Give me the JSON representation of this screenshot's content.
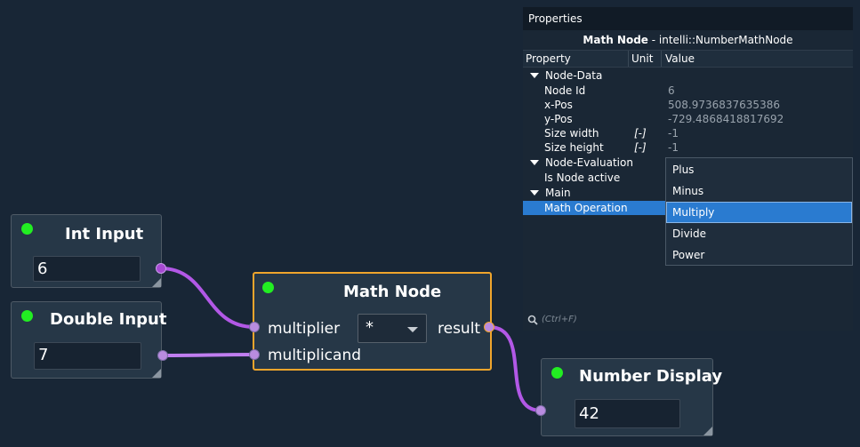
{
  "nodes": {
    "int_input": {
      "title": "Int Input",
      "value": "6"
    },
    "double_input": {
      "title": "Double Input",
      "value": "7"
    },
    "math_node": {
      "title": "Math Node",
      "in_ports": [
        "multiplier",
        "multiplicand"
      ],
      "out_port": "result",
      "operation": "*"
    },
    "number_display": {
      "title": "Number Display",
      "value": "42"
    }
  },
  "properties": {
    "panel_title": "Properties",
    "node_name": "Math Node",
    "node_class": " - intelli::NumberMathNode",
    "columns": {
      "property": "Property",
      "unit": "Unit",
      "value": "Value"
    },
    "groups": {
      "node_data": "Node-Data",
      "node_evaluation": "Node-Evaluation",
      "main": "Main"
    },
    "rows": {
      "node_id": {
        "label": "Node Id",
        "value": "6"
      },
      "x_pos": {
        "label": "x-Pos",
        "value": "508.9736837635386"
      },
      "y_pos": {
        "label": "y-Pos",
        "value": "-729.4868418817692"
      },
      "size_width": {
        "label": "Size width",
        "unit": "[-]",
        "value": "-1"
      },
      "size_height": {
        "label": "Size height",
        "unit": "[-]",
        "value": "-1"
      },
      "is_node_active": {
        "label": "Is Node active"
      },
      "math_operation": {
        "label": "Math Operation"
      }
    },
    "search_hint": "(Ctrl+F)"
  },
  "operation_menu": {
    "options": [
      "Plus",
      "Minus",
      "Multiply",
      "Divide",
      "Power"
    ],
    "selected": "Multiply"
  },
  "colors": {
    "background": "#182636",
    "node_fill": "#263747",
    "selected_border": "#f0a52c",
    "status_active": "#22ee22",
    "connection": "#b258e6",
    "port": "#b98ce0",
    "highlight": "#2a7bd0"
  },
  "icons": {
    "status": "green-dot-icon",
    "search": "magnifier-icon",
    "expand": "triangle-down-icon",
    "dropdown": "chevron-down-icon",
    "resize": "resize-grip-icon"
  }
}
